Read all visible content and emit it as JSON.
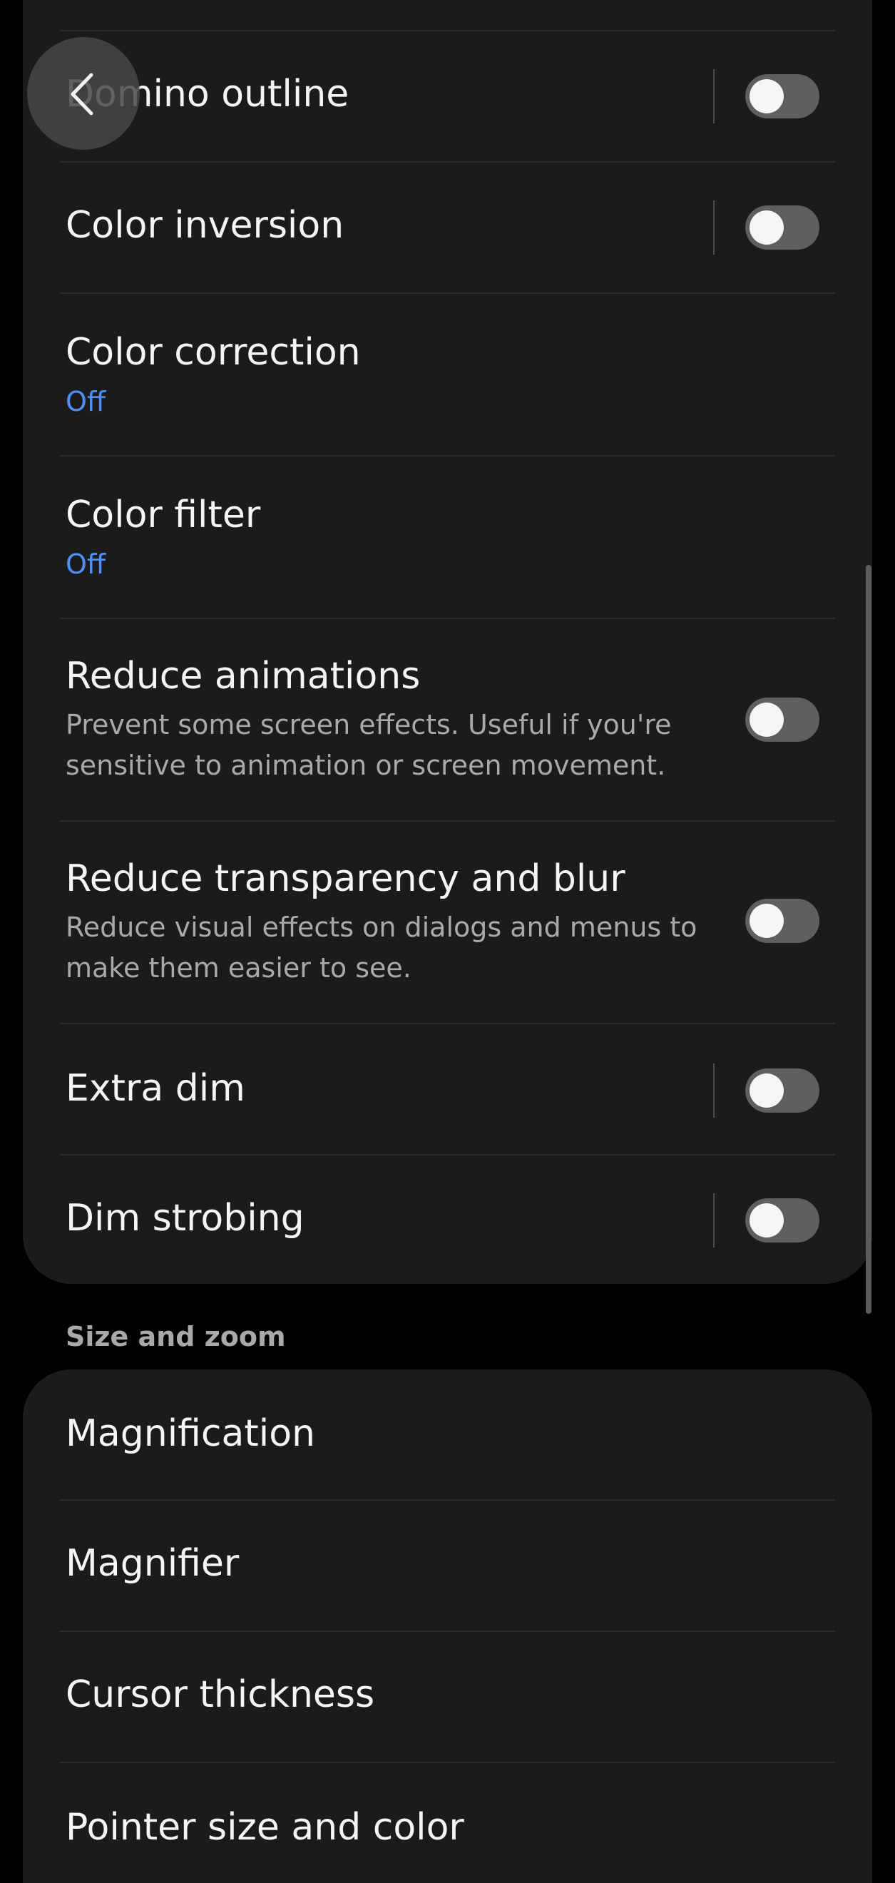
{
  "nav": {
    "back_icon": "chevron-left-icon"
  },
  "visibility_list": {
    "items": [
      {
        "title": "Domino outline",
        "toggle": "off"
      },
      {
        "title": "Color inversion",
        "toggle": "off"
      },
      {
        "title": "Color correction",
        "status": "Off"
      },
      {
        "title": "Color filter",
        "status": "Off"
      },
      {
        "title": "Reduce animations",
        "description": "Prevent some screen effects. Useful if you're sensitive to animation or screen movement.",
        "toggle": "off"
      },
      {
        "title": "Reduce transparency and blur",
        "description": "Reduce visual effects on dialogs and menus to make them easier to see.",
        "toggle": "off"
      },
      {
        "title": "Extra dim",
        "toggle": "off"
      },
      {
        "title": "Dim strobing",
        "toggle": "off"
      }
    ]
  },
  "size_zoom": {
    "header": "Size and zoom",
    "items": [
      {
        "title": "Magnification"
      },
      {
        "title": "Magnifier"
      },
      {
        "title": "Cursor thickness"
      },
      {
        "title": "Pointer size and color"
      }
    ]
  },
  "colors": {
    "background": "#000000",
    "card": "#1b1b1c",
    "accent_status": "#4f8ff7",
    "toggle_track_off": "#5f5f62"
  }
}
